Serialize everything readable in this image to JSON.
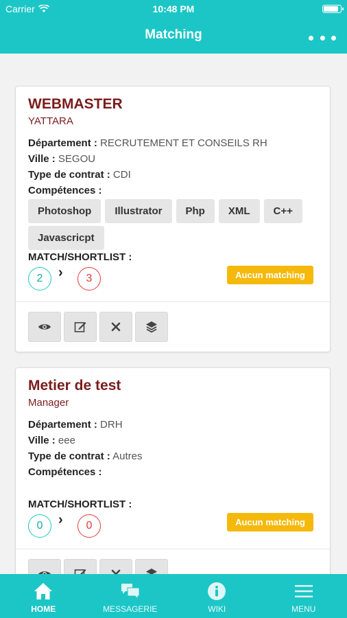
{
  "status": {
    "carrier": "Carrier",
    "time": "10:48 PM",
    "battery_level": 0.9
  },
  "header": {
    "title": "Matching"
  },
  "labels": {
    "departement": "Département :",
    "ville": "Ville :",
    "contrat": "Type de contrat :",
    "competences": "Compétences :",
    "match": "MATCH/SHORTLIST :",
    "chevron": "›"
  },
  "cards": [
    {
      "title": "WEBMASTER",
      "company": "YATTARA",
      "departement": "RECRUTEMENT ET CONSEILS RH",
      "ville": "SEGOU",
      "contrat": "CDI",
      "competences": [
        "Photoshop",
        "Illustrator",
        "Php",
        "XML",
        "C++",
        "Javascricpt"
      ],
      "match_count": "2",
      "shortlist_count": "3",
      "badge": "Aucun matching"
    },
    {
      "title": "Metier de test",
      "company": "Manager",
      "departement": "DRH",
      "ville": "eee",
      "contrat": "Autres",
      "competences": [],
      "match_count": "0",
      "shortlist_count": "0",
      "badge": "Aucun matching"
    }
  ],
  "tabs": [
    {
      "label": "HOME",
      "icon": "home-icon",
      "active": true
    },
    {
      "label": "MESSAGERIE",
      "icon": "chat-icon",
      "active": false
    },
    {
      "label": "WIKI",
      "icon": "info-icon",
      "active": false
    },
    {
      "label": "MENU",
      "icon": "menu-icon",
      "active": false
    }
  ],
  "colors": {
    "primary": "#1cc6c6",
    "title": "#7a1c1c",
    "badge": "#f5b90c",
    "red": "#e03a3a"
  }
}
